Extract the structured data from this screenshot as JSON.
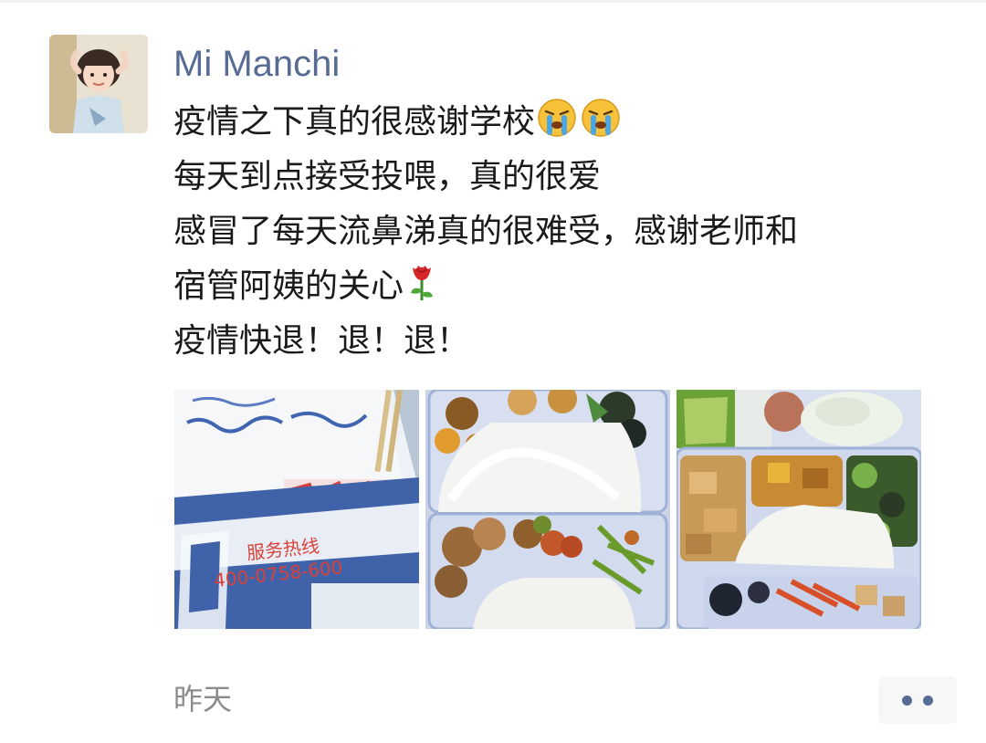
{
  "post": {
    "author_name": "Mi Manchi",
    "lines": [
      "疫情之下真的很感谢学校",
      "每天到点接受投喂，真的很爱",
      "感冒了每天流鼻涕真的很难受，感谢老师和",
      "宿管阿姨的关心",
      "疫情快退！退！退！"
    ],
    "images": [
      {
        "name": "photo-medicine-bag",
        "text_lines": [
          "服务热线",
          "400-0758-600"
        ]
      },
      {
        "name": "photo-lunch-boxes"
      },
      {
        "name": "photo-lunch-box-tofu"
      }
    ],
    "timestamp": "昨天"
  },
  "icons": {
    "line1_emoji": "loudly-crying-face-icon",
    "line4_emoji": "rose-icon",
    "more_button": "more-dots-icon"
  },
  "colors": {
    "author_name": "#576b95",
    "body_text": "#1a1a1a",
    "timestamp": "#8b8b8b",
    "more_button_bg": "#f7f7f7"
  }
}
